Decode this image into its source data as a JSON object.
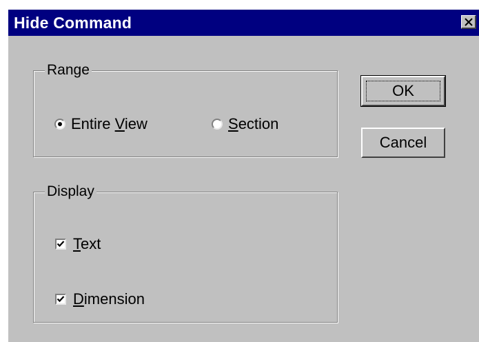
{
  "window": {
    "title": "Hide Command",
    "close_icon": "close-icon"
  },
  "range": {
    "label": "Range",
    "options": [
      {
        "pre": "Entire ",
        "mnemonic": "V",
        "post": "iew",
        "selected": true
      },
      {
        "pre": "",
        "mnemonic": "S",
        "post": "ection",
        "selected": false
      }
    ]
  },
  "display": {
    "label": "Display",
    "options": [
      {
        "pre": "",
        "mnemonic": "T",
        "post": "ext",
        "checked": true
      },
      {
        "pre": "",
        "mnemonic": "D",
        "post": "imension",
        "checked": true
      }
    ]
  },
  "buttons": {
    "ok_label": "OK",
    "cancel_label": "Cancel"
  },
  "colors": {
    "titlebar": "#000080",
    "dialog_face": "#c0c0c0"
  }
}
